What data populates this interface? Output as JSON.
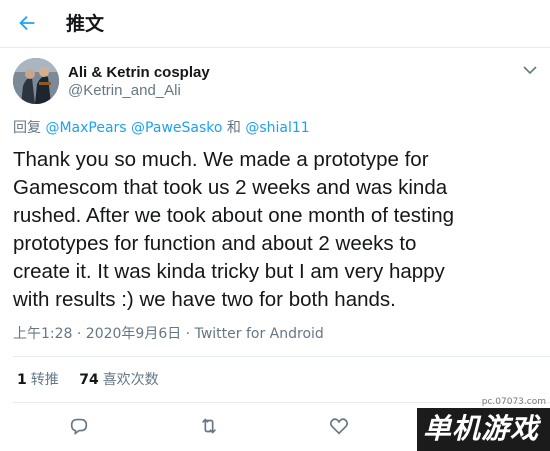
{
  "header": {
    "title": "推文",
    "back_icon": "arrow-left-icon"
  },
  "author": {
    "name": "Ali & Ketrin cosplay",
    "handle": "@Ketrin_and_Ali"
  },
  "reply": {
    "prefix": "回复",
    "mentions": [
      "@MaxPears",
      "@PaweSasko"
    ],
    "conjunction": "和",
    "last_mention": "@shial11"
  },
  "tweet": {
    "lines": [
      "Thank you so much. We made a prototype for",
      "Gamescom that took us 2 weeks and was kinda",
      "rushed. After we took about one month of testing",
      "prototypes for function and about 2 weeks to",
      "create it. It was kinda tricky but I am very happy",
      "with results :) we have two for both hands."
    ]
  },
  "meta": {
    "time": "上午1:28 · 2020年9月6日 · Twitter for Android"
  },
  "stats": {
    "retweets": "1",
    "retweets_label": "转推",
    "likes": "74",
    "likes_label": "喜欢次数"
  },
  "actions": [
    "reply-icon",
    "retweet-icon",
    "like-icon",
    "share-icon"
  ],
  "watermark": {
    "text": "单机游戏",
    "url": "pc.07073.com"
  },
  "colors": {
    "accent": "#1da1f2",
    "secondary_text": "#657786",
    "border": "#e6ecf0"
  }
}
